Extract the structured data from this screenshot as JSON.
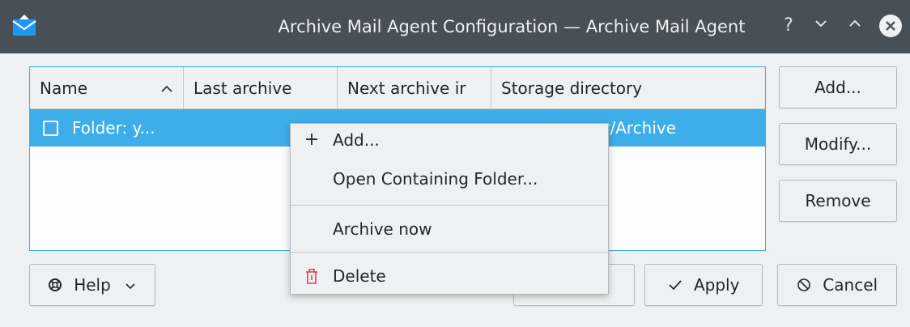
{
  "window": {
    "title": "Archive Mail Agent Configuration — Archive Mail Agent",
    "controls": {
      "help": "?",
      "minimize": "⌄",
      "maximize": "⌃",
      "close": "✕"
    }
  },
  "table": {
    "columns": [
      "Name",
      "Last archive",
      "Next archive ir",
      "Storage directory"
    ],
    "sort_indicator": "^",
    "rows": [
      {
        "name": "Folder: y...",
        "storage": "/ ... ... or/Archive",
        "storage_visible": "or/Archive",
        "checked": false,
        "selected": true
      }
    ]
  },
  "buttons": {
    "add": "Add...",
    "modify": "Modify...",
    "remove": "Remove",
    "help": "Help",
    "apply": "Apply",
    "cancel": "Cancel"
  },
  "context_menu": {
    "items": [
      {
        "label": "Add...",
        "icon": "plus-icon",
        "glyph": "+"
      },
      {
        "label": "Open Containing Folder...",
        "icon": "",
        "glyph": ""
      },
      {
        "label": "Archive now",
        "icon": "",
        "glyph": ""
      },
      {
        "label": "Delete",
        "icon": "trash-icon",
        "glyph": "🗑"
      }
    ]
  },
  "colors": {
    "titlebar": "#475057",
    "accent": "#3daee9",
    "window_bg": "#eff0f1"
  }
}
